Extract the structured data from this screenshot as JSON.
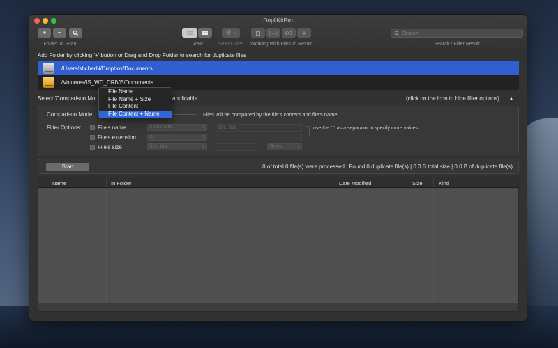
{
  "window": {
    "title": "DupliKitPro"
  },
  "toolbar": {
    "add_icon": "plus-icon",
    "remove_icon": "minus-icon",
    "scan_icon": "magnifier-icon",
    "list_view_icon": "list-icon",
    "grid_view_icon": "grid-icon",
    "select_icon": "gear-icon",
    "trash_icon": "trash-icon",
    "move_icon": "move-to-icon",
    "preview_icon": "eye-icon",
    "tag_icon": "tag-icon",
    "labels": {
      "folder_to_scan": "Folder To Scan",
      "view": "View",
      "select_files": "Select Files",
      "working_with_files": "Working With Files In Result",
      "search_filter": "Search / Filter Result"
    },
    "search_placeholder": "Search"
  },
  "hint": "Add Folder by clicking '+' button or Drag and Drop Folder to search for duplicate files",
  "folders": [
    {
      "path": "/Users/shcherbi/Dropbox/Documents",
      "icon": "hard-drive-icon",
      "selected": true
    },
    {
      "path": "/Volumes/IS_WD_DRIVE/Documents",
      "icon": "external-drive-icon",
      "selected": false
    }
  ],
  "comparison": {
    "prompt_start": "Select 'Comparison Mo",
    "prompt_end": "applicable",
    "hide_hint": "(click on the icon to hide filter options)",
    "mode_label": "Comparison Mode:",
    "mode_description": "Files will be compared by the file's content and file's name",
    "options": [
      "File Name",
      "File Name + Size",
      "File Content",
      "File Content + Name"
    ],
    "selected_option": "File Content + Name"
  },
  "filters": {
    "label": "Filter Options:",
    "name": {
      "label": "File's name",
      "operator": "starts with",
      "value": "dsc, doc"
    },
    "extension": {
      "label": "File's extension",
      "operator": "is"
    },
    "size": {
      "label": "File's size",
      "operator": "less than",
      "unit": "Bytes"
    },
    "separator_hint": "use the \";\" as a separator to specify more values."
  },
  "scan": {
    "start_label": "Start",
    "stats": "0 of total 0 file(s) were processed | Found 0 duplicate file(s) |  0.0 B  total size |  0.0 B  of duplicate file(s)"
  },
  "results": {
    "columns": [
      "Name",
      "In Folder",
      "Date Modified",
      "Size",
      "Kind"
    ]
  }
}
